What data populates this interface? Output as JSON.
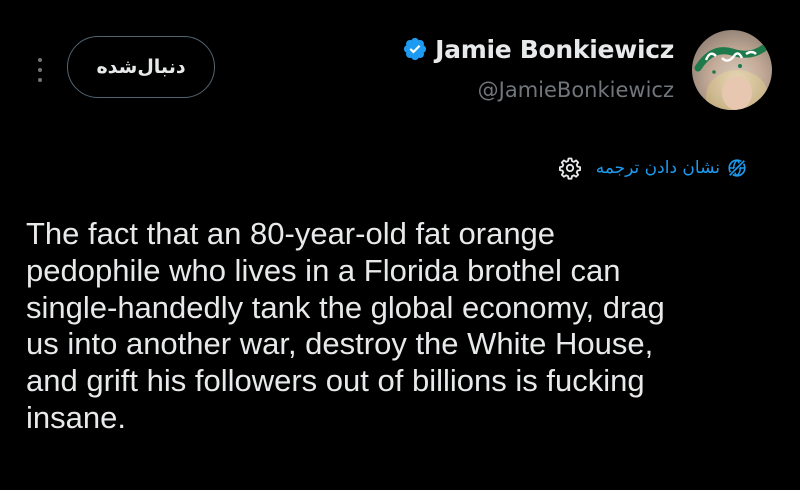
{
  "tweet_header": {
    "follow_button_label": "دنبال‌شده",
    "display_name": "Jamie Bonkiewicz",
    "handle": "@JamieBonkiewicz",
    "verified": true,
    "verified_color": "#1d9bf0"
  },
  "avatar": {
    "watermark_text": "خبر فوری",
    "watermark_color": "#1e7a4a"
  },
  "translate": {
    "label": "نشان دادن ترجمه",
    "link_color": "#1d9bf0"
  },
  "tweet_body": {
    "lines": [
      "The fact that an 80-year-old fat orange",
      "pedophile who lives in a Florida brothel can",
      "single-handedly tank the global economy, drag",
      "us into another war, destroy the White House,",
      "and grift his followers out of billions is fucking",
      "insane."
    ]
  },
  "icons": {
    "more": "more-vertical-icon",
    "verified": "verified-badge-icon",
    "settings": "gear-icon",
    "translate": "globe-icon"
  },
  "theme": {
    "background": "#000000",
    "text": "#e7e9ea",
    "secondary_text": "#71767b",
    "border": "#536471"
  }
}
